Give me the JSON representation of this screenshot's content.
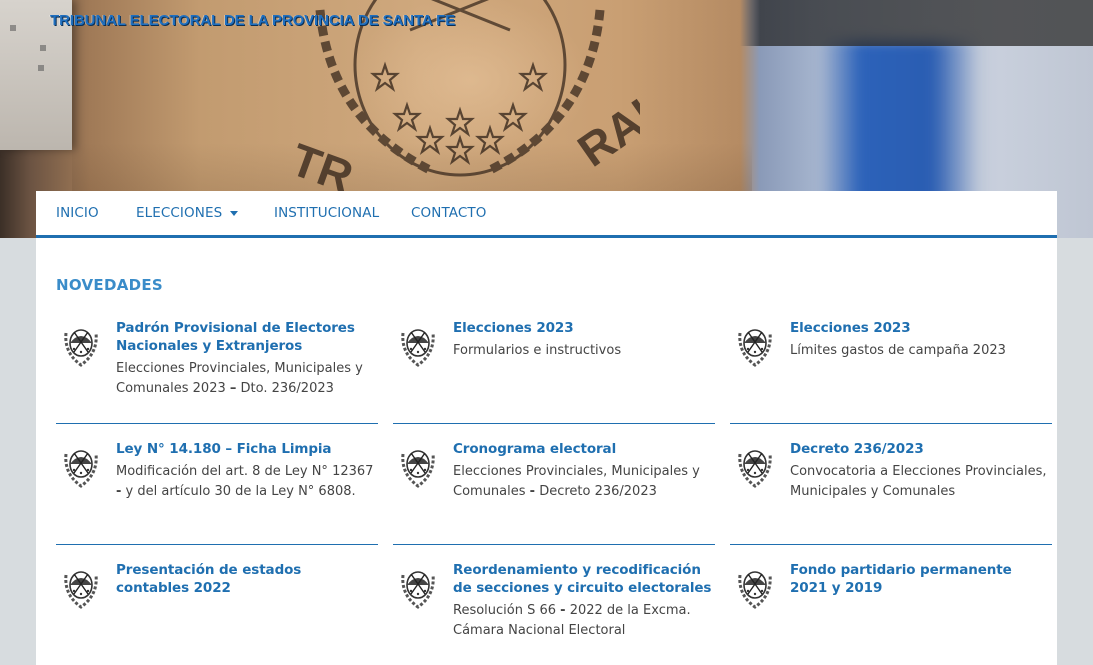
{
  "site": {
    "title": "TRIBUNAL ELECTORAL DE LA PROVINCIA DE SANTA FE"
  },
  "nav": {
    "items": [
      {
        "label": "INICIO"
      },
      {
        "label": "ELECCIONES"
      },
      {
        "label": "INSTITUCIONAL"
      },
      {
        "label": "CONTACTO"
      }
    ]
  },
  "news": {
    "heading": "NOVEDADES",
    "items": [
      {
        "title": "Padrón Provisional de Electores Nacionales y Extranjeros",
        "desc_pre": "Elecciones Provinciales, Municipales y Comunales 2023 ",
        "desc_strong": "–",
        "desc_post": " Dto. 236/2023"
      },
      {
        "title": "Elecciones 2023",
        "desc_pre": "Formularios e instructivos",
        "desc_strong": "",
        "desc_post": ""
      },
      {
        "title": "Elecciones 2023",
        "desc_pre": "Límites gastos de campaña 2023",
        "desc_strong": "",
        "desc_post": ""
      },
      {
        "title": "Ley N° 14.180 – Ficha Limpia",
        "desc_pre": "Modificación del art. 8 de Ley N° 12367 ",
        "desc_strong": "-",
        "desc_post": " y del artículo 30 de la Ley N° 6808."
      },
      {
        "title": "Cronograma electoral",
        "desc_pre": "Elecciones Provinciales, Municipales y Comunales ",
        "desc_strong": "-",
        "desc_post": " Decreto 236/2023"
      },
      {
        "title": "Decreto 236/2023",
        "desc_pre": "Convocatoria a Elecciones Provinciales, Municipales y Comunales",
        "desc_strong": "",
        "desc_post": ""
      },
      {
        "title": "Presentación de estados contables 2022",
        "desc_pre": "",
        "desc_strong": "",
        "desc_post": ""
      },
      {
        "title": "Reordenamiento y recodificación de secciones y circuito electorales",
        "desc_pre": "Resolución S 66 ",
        "desc_strong": "-",
        "desc_post": " 2022 de la Excma. Cámara Nacional Electoral"
      },
      {
        "title": "Fondo partidario permanente 2021 y 2019",
        "desc_pre": "",
        "desc_strong": "",
        "desc_post": ""
      }
    ]
  },
  "icons": {
    "thumb": "santa-fe-shield-icon",
    "caret": "chevron-down-icon"
  },
  "colors": {
    "accent": "#1f6fb0",
    "heading": "#3a8cc9",
    "text": "#444444",
    "background": "#d7dcdf"
  }
}
